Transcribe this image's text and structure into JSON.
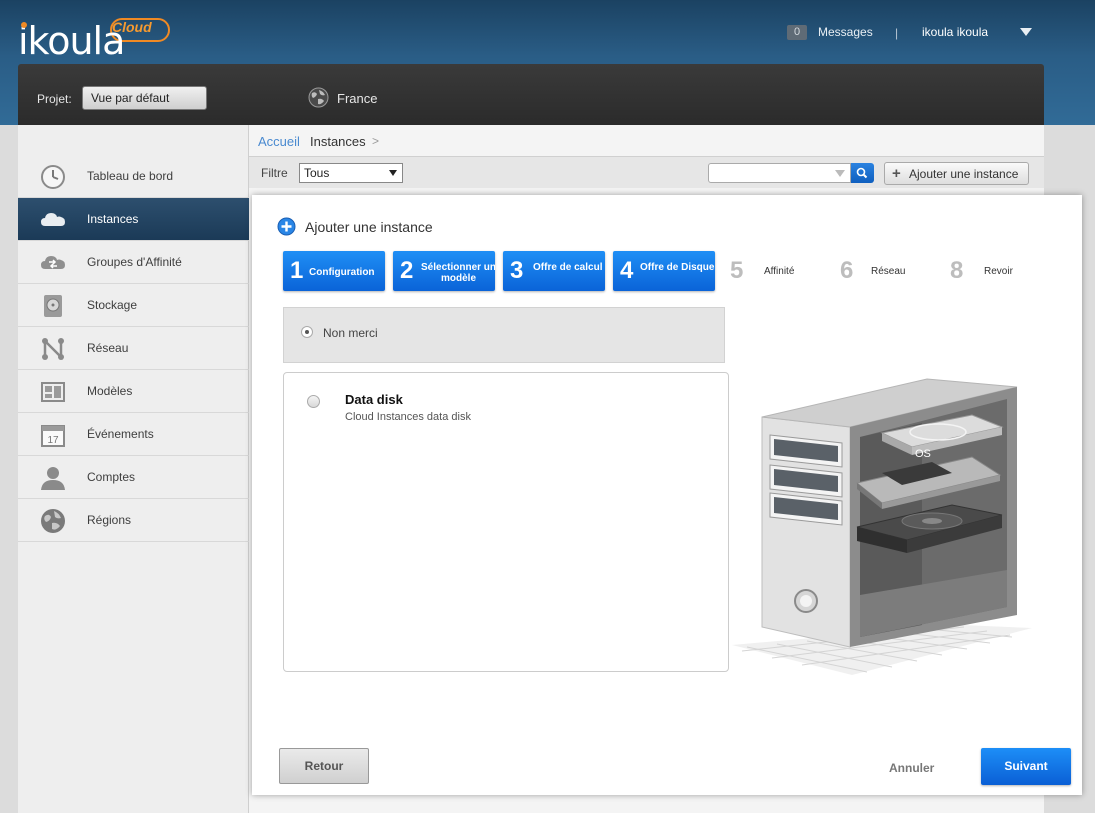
{
  "header": {
    "logo_text": "ikoula",
    "logo_cloud": "Cloud",
    "messages_count": "0",
    "messages_label": "Messages",
    "separator": "|",
    "user_name": "ikoula ikoula"
  },
  "project_bar": {
    "label": "Projet:",
    "selected": "Vue par défaut",
    "zone": "France"
  },
  "sidebar": {
    "items": [
      {
        "label": "Tableau de bord",
        "icon": "dashboard-icon"
      },
      {
        "label": "Instances",
        "icon": "cloud-icon",
        "active": true
      },
      {
        "label": "Groupes d'Affinité",
        "icon": "affinity-icon"
      },
      {
        "label": "Stockage",
        "icon": "storage-icon"
      },
      {
        "label": "Réseau",
        "icon": "network-icon"
      },
      {
        "label": "Modèles",
        "icon": "templates-icon"
      },
      {
        "label": "Événements",
        "icon": "calendar-icon"
      },
      {
        "label": "Comptes",
        "icon": "user-icon"
      },
      {
        "label": "Régions",
        "icon": "globe-icon"
      }
    ],
    "calendar_day": "17"
  },
  "breadcrumb": {
    "home": "Accueil",
    "current": "Instances",
    "arrow": ">"
  },
  "filter": {
    "label": "Filtre",
    "selected": "Tous",
    "add_button": "Ajouter une instance",
    "add_plus": "+"
  },
  "modal": {
    "title": "Ajouter une instance",
    "steps": [
      {
        "num": "1",
        "label": "Configuration"
      },
      {
        "num": "2",
        "label": "Sélectionner un",
        "label2": "modèle"
      },
      {
        "num": "3",
        "label": "Offre de calcul"
      },
      {
        "num": "4",
        "label": "Offre de Disque"
      },
      {
        "num": "5",
        "label": "Affinité"
      },
      {
        "num": "6",
        "label": "Réseau"
      },
      {
        "num": "8",
        "label": "Revoir"
      }
    ],
    "option_none": "Non merci",
    "disk_offer": {
      "name": "Data disk",
      "description": "Cloud Instances data disk"
    },
    "illustration_label": "OS",
    "back_button": "Retour",
    "cancel_button": "Annuler",
    "next_button": "Suivant"
  },
  "colors": {
    "header_blue": "#2a5d86",
    "accent_blue": "#0a63d8",
    "logo_orange": "#f08a24",
    "active_nav": "#1b3a57"
  }
}
